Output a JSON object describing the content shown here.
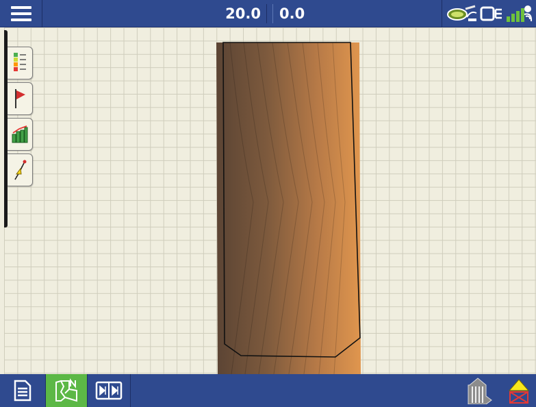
{
  "header": {
    "speed_value": "20.0",
    "offset_value": "0.0",
    "menu_icon": "hamburger-menu-icon",
    "status_icons": [
      "rtk-correction-icon",
      "ecu-module-icon",
      "gps-satellite-signal-icon"
    ]
  },
  "side_tools": [
    {
      "name": "legend-tool",
      "icon": "legend-icon"
    },
    {
      "name": "flag-tool",
      "icon": "flag-icon"
    },
    {
      "name": "summary-chart-tool",
      "icon": "bar-chart-icon"
    },
    {
      "name": "guidance-line-tool",
      "icon": "guidance-line-icon"
    }
  ],
  "bottom_bar": {
    "buttons": [
      {
        "name": "run-screen",
        "icon": "document-icon",
        "active": false
      },
      {
        "name": "map-view",
        "icon": "map-north-icon",
        "active": true
      },
      {
        "name": "split-view",
        "icon": "split-screen-icon",
        "active": false
      },
      {
        "name": "implement-state",
        "icon": "implement-section-icon",
        "active": false
      },
      {
        "name": "alert",
        "icon": "warning-alarm-icon",
        "active": false
      }
    ]
  },
  "colors": {
    "bar_blue": "#2f4a8f",
    "active_green": "#5cb846",
    "map_background": "#f0eedf",
    "coverage_dark": "#5b4434",
    "coverage_light": "#e0964e"
  }
}
